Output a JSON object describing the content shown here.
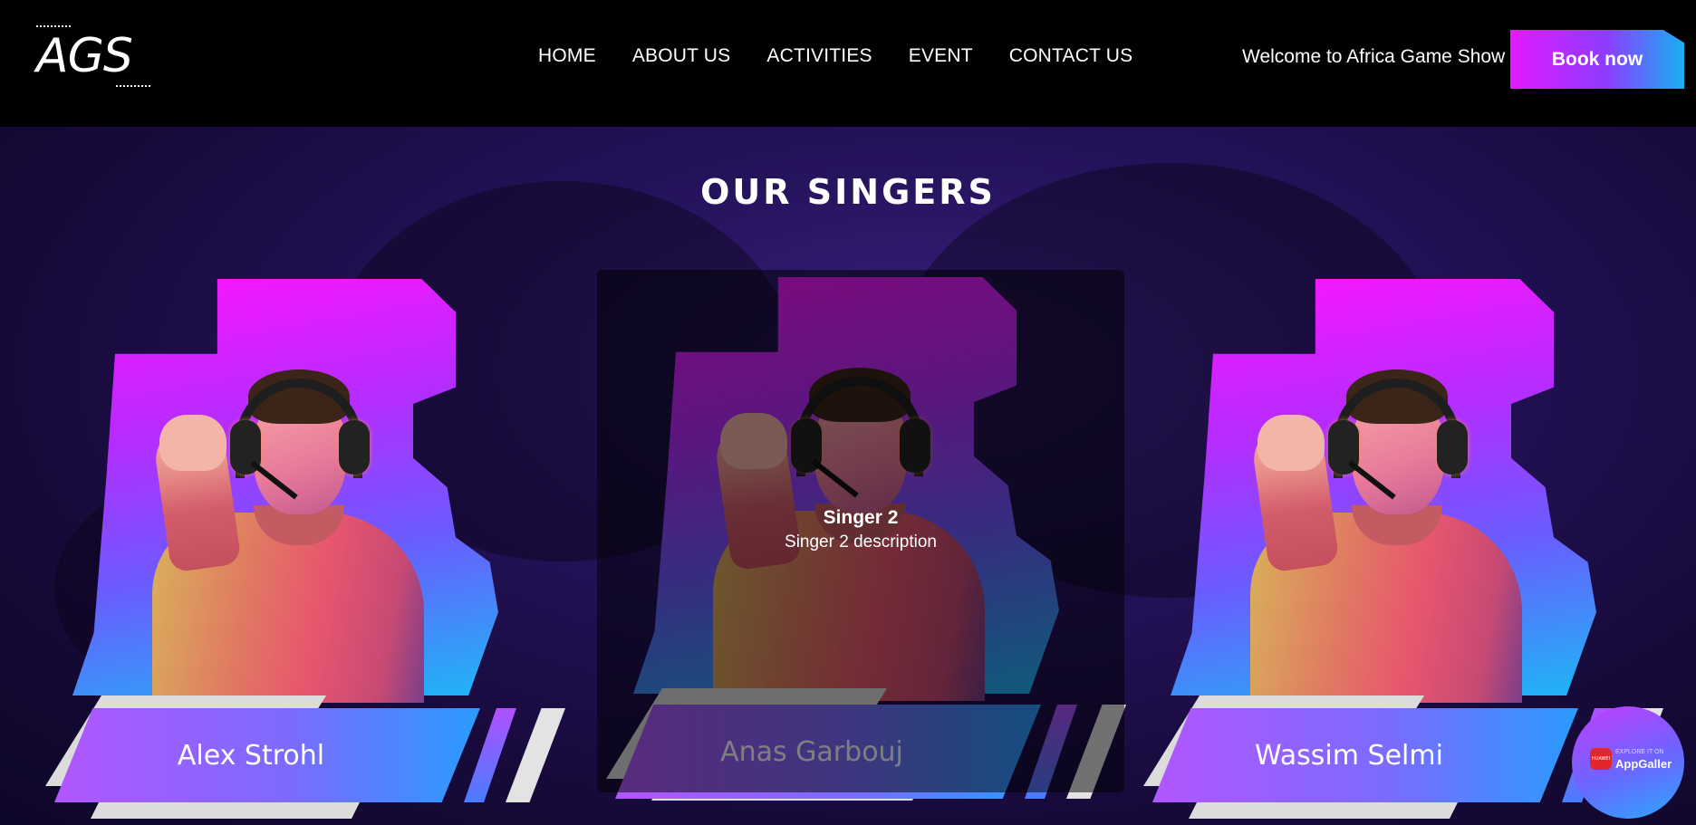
{
  "header": {
    "logo_text": "AGS",
    "nav": [
      {
        "label": "HOME"
      },
      {
        "label": "ABOUT US"
      },
      {
        "label": "ACTIVITIES"
      },
      {
        "label": "EVENT"
      },
      {
        "label": "CONTACT US"
      }
    ],
    "welcome": "Welcome to Africa Game Show",
    "book_label": "Book now"
  },
  "main": {
    "section_title": "OUR SINGERS",
    "singers": [
      {
        "name": "Alex Strohl"
      },
      {
        "name": "Anas Garbouj",
        "hover_title": "Singer 2",
        "hover_description": "Singer 2 description"
      },
      {
        "name": "Wassim Selmi"
      }
    ]
  },
  "badge": {
    "small_text": "EXPLORE IT ON",
    "label": "AppGaller",
    "icon_text": "HUAWEI"
  },
  "colors": {
    "accent_magenta": "#e21aff",
    "accent_blue": "#16b0f2",
    "background_purple": "#24125a"
  }
}
